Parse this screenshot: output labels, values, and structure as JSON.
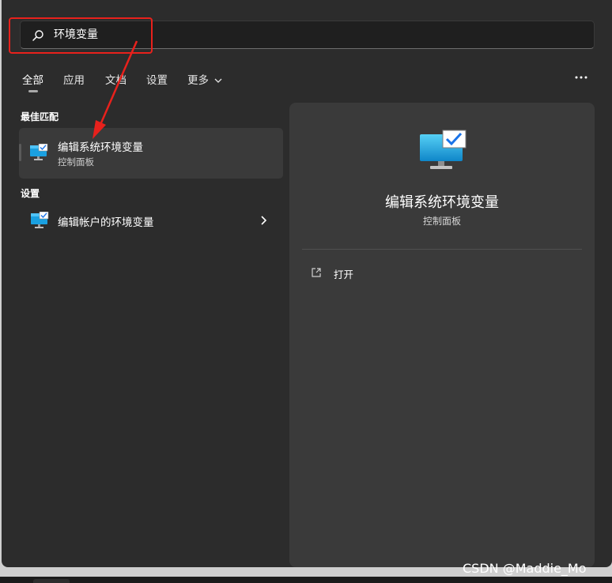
{
  "search": {
    "value": "环境变量"
  },
  "tabs": [
    {
      "label": "全部"
    },
    {
      "label": "应用"
    },
    {
      "label": "文档"
    },
    {
      "label": "设置"
    },
    {
      "label": "更多"
    }
  ],
  "best_match": {
    "heading": "最佳匹配",
    "title": "编辑系统环境变量",
    "subtitle": "控制面板"
  },
  "settings": {
    "heading": "设置",
    "items": [
      {
        "title": "编辑帐户的环境变量"
      }
    ]
  },
  "details": {
    "title": "编辑系统环境变量",
    "subtitle": "控制面板",
    "actions": [
      {
        "label": "打开"
      }
    ]
  },
  "watermark": "CSDN @Maddie_Mo",
  "colors": {
    "background": "#2c2c2c",
    "card": "#3a3a3a",
    "annotation_red": "#e8211c",
    "accent_blue": "#1aa0e0"
  },
  "icons": [
    "search-icon",
    "chevron-down-icon",
    "more-dots-icon",
    "control-panel-monitor-icon",
    "chevron-right-icon",
    "open-external-icon"
  ]
}
